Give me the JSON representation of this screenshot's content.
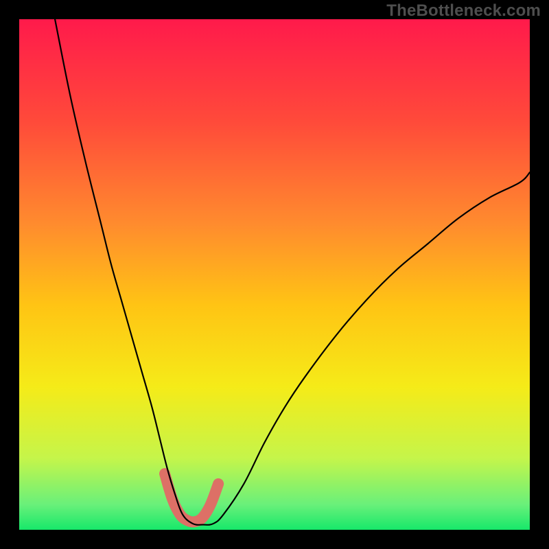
{
  "watermark": {
    "text": "TheBottleneck.com"
  },
  "chart_data": {
    "type": "line",
    "title": "",
    "xlabel": "",
    "ylabel": "",
    "xlim": [
      0,
      100
    ],
    "ylim": [
      0,
      100
    ],
    "grid": false,
    "legend": false,
    "background_gradient_stops": [
      {
        "offset": 0.0,
        "color": "#ff1a4b"
      },
      {
        "offset": 0.2,
        "color": "#ff4a3a"
      },
      {
        "offset": 0.4,
        "color": "#ff8b2e"
      },
      {
        "offset": 0.56,
        "color": "#ffc414"
      },
      {
        "offset": 0.72,
        "color": "#f5eb18"
      },
      {
        "offset": 0.86,
        "color": "#c5f54a"
      },
      {
        "offset": 0.95,
        "color": "#6af07a"
      },
      {
        "offset": 1.0,
        "color": "#17e86a"
      }
    ],
    "series": [
      {
        "name": "bottleneck-curve",
        "x": [
          7,
          10,
          13,
          16,
          18,
          20,
          22,
          24,
          26,
          27.5,
          29,
          30.5,
          32,
          34,
          36,
          38,
          40,
          44,
          48,
          52,
          56,
          62,
          68,
          74,
          80,
          86,
          92,
          98,
          100
        ],
        "y": [
          100,
          85,
          72,
          60,
          52,
          45,
          38,
          31,
          24,
          18,
          12,
          7,
          3,
          1.2,
          1.0,
          1.2,
          3,
          9,
          17,
          24,
          30,
          38,
          45,
          51,
          56,
          61,
          65,
          68,
          70
        ]
      }
    ],
    "emphasis_segment": {
      "name": "optimal-range-highlight",
      "x": [
        28.5,
        30,
        31.5,
        33,
        34.5,
        36,
        37.5,
        39
      ],
      "y": [
        11,
        6,
        3,
        1.8,
        1.6,
        2.5,
        5,
        9
      ]
    }
  }
}
